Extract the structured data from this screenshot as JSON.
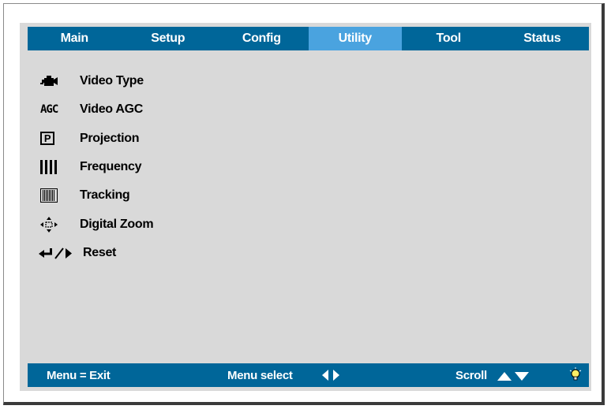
{
  "tabs": [
    {
      "label": "Main"
    },
    {
      "label": "Setup"
    },
    {
      "label": "Config"
    },
    {
      "label": "Utility",
      "active": true
    },
    {
      "label": "Tool"
    },
    {
      "label": "Status"
    }
  ],
  "menu": {
    "items": [
      {
        "label": "Video Type",
        "icon": "video-type-icon"
      },
      {
        "label": "Video AGC",
        "icon": "agc-icon",
        "icon_text": "AGC"
      },
      {
        "label": "Projection",
        "icon": "projection-icon",
        "icon_text": "P"
      },
      {
        "label": "Frequency",
        "icon": "frequency-icon"
      },
      {
        "label": "Tracking",
        "icon": "tracking-icon"
      },
      {
        "label": "Digital Zoom",
        "icon": "digital-zoom-icon"
      },
      {
        "label": "Reset",
        "icon": "reset-icon"
      }
    ]
  },
  "statusbar": {
    "exit_label": "Menu = Exit",
    "select_label": "Menu select",
    "scroll_label": "Scroll",
    "select_icon": "left-right-arrows-icon",
    "scroll_icon": "up-down-arrows-icon",
    "help_icon": "lightbulb-icon"
  },
  "colors": {
    "bar": "#006699",
    "active_tab": "#4aa3df",
    "panel": "#d9d9d9"
  }
}
